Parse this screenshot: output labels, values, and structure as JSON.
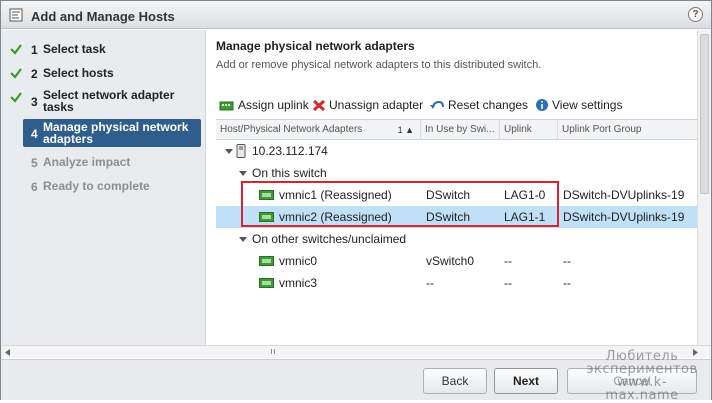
{
  "window": {
    "title": "Add and Manage Hosts",
    "help_label": "?"
  },
  "steps": [
    {
      "num": "1",
      "label": "Select task",
      "state": "done"
    },
    {
      "num": "2",
      "label": "Select hosts",
      "state": "done"
    },
    {
      "num": "3",
      "label": "Select network adapter tasks",
      "state": "done"
    },
    {
      "num": "4",
      "label": "Manage physical network adapters",
      "state": "current"
    },
    {
      "num": "5",
      "label": "Analyze impact",
      "state": "future"
    },
    {
      "num": "6",
      "label": "Ready to complete",
      "state": "future"
    }
  ],
  "content": {
    "title": "Manage physical network adapters",
    "subtitle": "Add or remove physical network adapters to this distributed switch."
  },
  "toolbar": {
    "assign_uplink": "Assign uplink",
    "unassign_adapter": "Unassign adapter",
    "reset_changes": "Reset changes",
    "view_settings": "View settings"
  },
  "grid": {
    "columns": [
      "Host/Physical Network Adapters",
      "In Use by Swi...",
      "Uplink",
      "Uplink Port Group"
    ],
    "sort_indicator": "1 ▲",
    "host": "10.23.112.174",
    "group_on_switch": "On this switch",
    "group_other": "On other switches/unclaimed",
    "rows_on_switch": [
      {
        "name": "vmnic1 (Reassigned)",
        "switch": "DSwitch",
        "uplink": "LAG1-0",
        "port_group": "DSwitch-DVUplinks-19",
        "selected": false
      },
      {
        "name": "vmnic2 (Reassigned)",
        "switch": "DSwitch",
        "uplink": "LAG1-1",
        "port_group": "DSwitch-DVUplinks-19",
        "selected": true
      }
    ],
    "rows_other": [
      {
        "name": "vmnic0",
        "switch": "vSwitch0",
        "uplink": "--",
        "port_group": "--"
      },
      {
        "name": "vmnic3",
        "switch": "--",
        "uplink": "--",
        "port_group": "--"
      }
    ]
  },
  "footer": {
    "back": "Back",
    "next": "Next",
    "cancel": "Cancel"
  },
  "watermark": {
    "line1": "Любитель",
    "line2": "экспериментов",
    "line3": "www.k-max.name"
  },
  "colors": {
    "selected_row": "#bfe0f7",
    "current_step": "#2f5d8c",
    "highlight_box": "#d6252f",
    "check": "#3a9b2f"
  }
}
